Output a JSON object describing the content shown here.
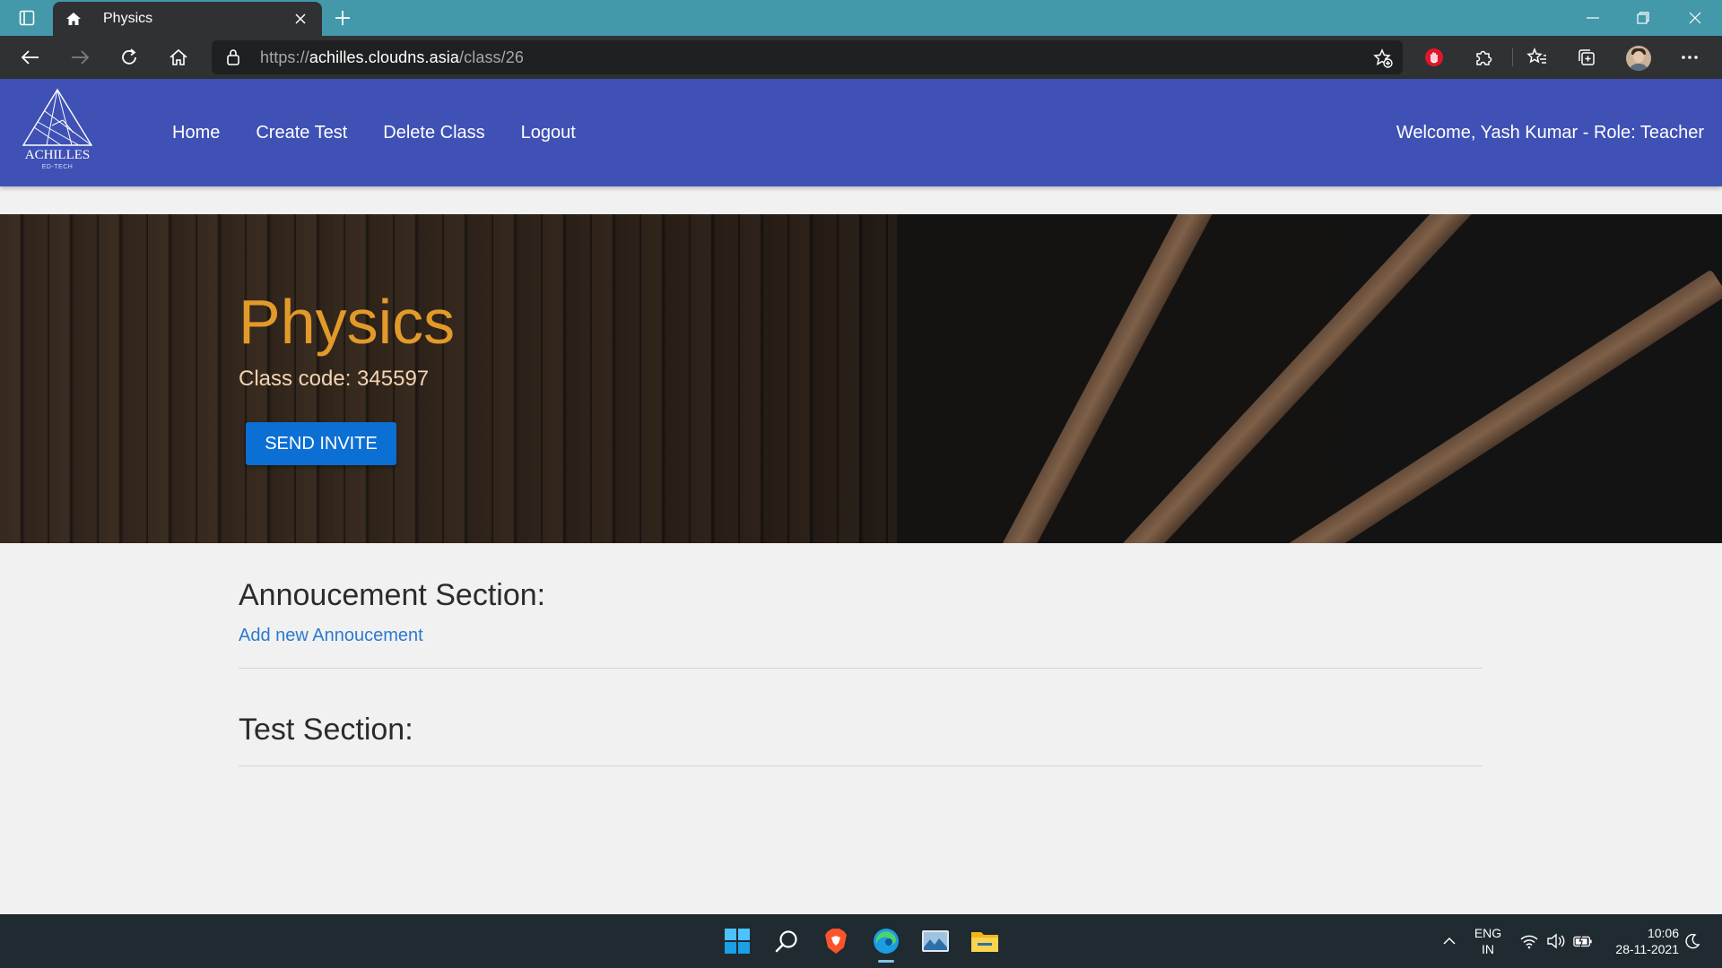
{
  "browser": {
    "tab_title": "Physics",
    "url_scheme": "https://",
    "url_host": "achilles.cloudns.asia",
    "url_path": "/class/26"
  },
  "site": {
    "logo_name": "ACHILLES",
    "logo_sub": "ED-TECH",
    "nav": [
      "Home",
      "Create Test",
      "Delete Class",
      "Logout"
    ],
    "welcome": "Welcome, Yash Kumar - Role: Teacher"
  },
  "hero": {
    "title": "Physics",
    "class_code": "Class code: 345597",
    "invite_label": "SEND INVITE"
  },
  "sections": {
    "announcement_title": "Annoucement Section:",
    "add_announcement": "Add new Annoucement",
    "test_title": "Test Section:"
  },
  "taskbar": {
    "lang_top": "ENG",
    "lang_bottom": "IN",
    "time": "10:06",
    "date": "28-11-2021"
  },
  "colors": {
    "header": "#3f51b5",
    "accent_title": "#e29a2a",
    "invite_button": "#0c6fd4",
    "link": "#2d79cf",
    "tabbar": "#4398aa"
  }
}
